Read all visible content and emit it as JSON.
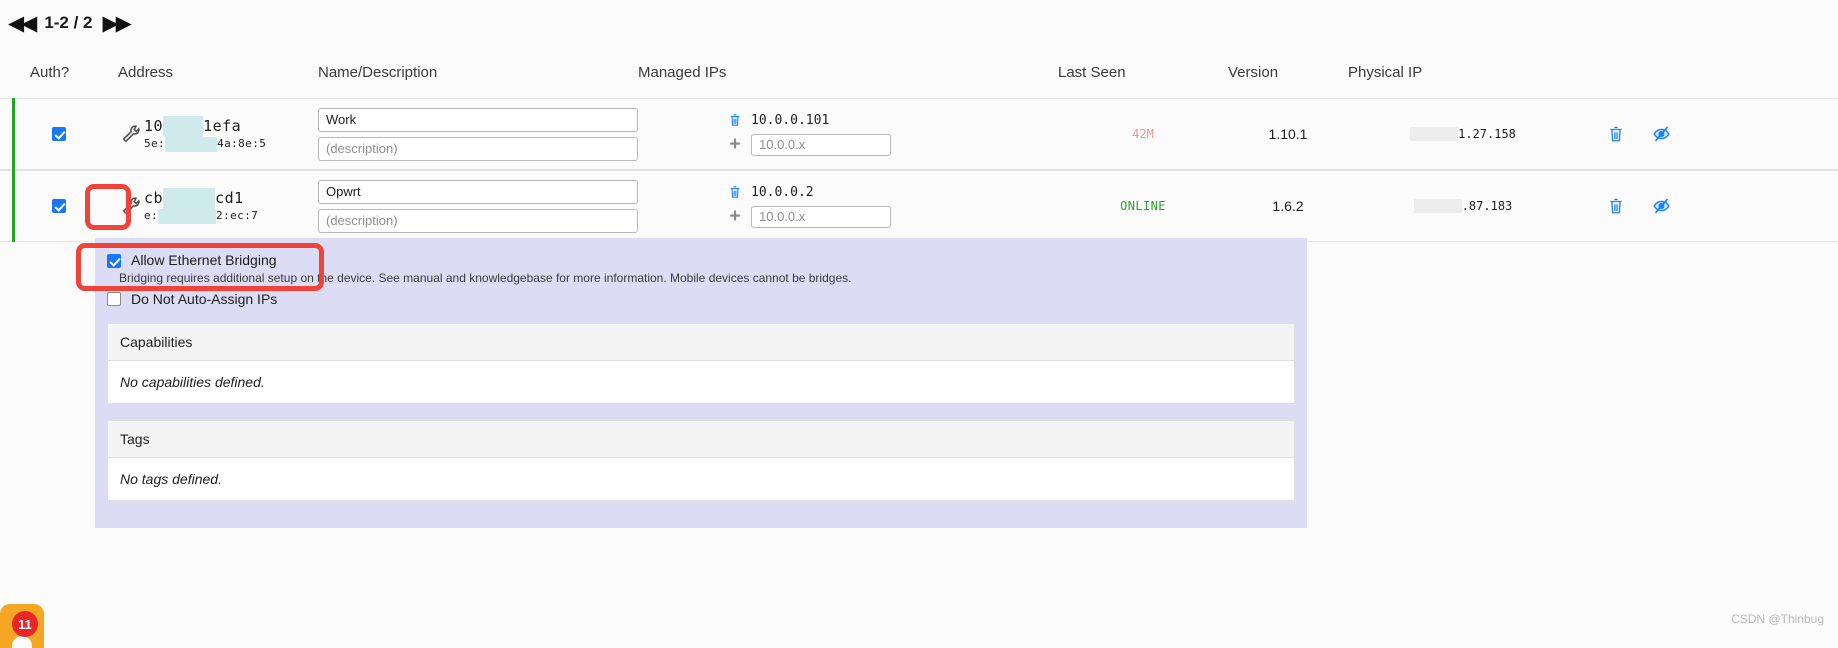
{
  "pagination": {
    "first_icon": "first-page-icon",
    "label": "1-2 / 2",
    "last_icon": "last-page-icon",
    "first_glyph": "◀◀",
    "last_glyph": "▶▶"
  },
  "table": {
    "columns": [
      "Auth?",
      "Address",
      "Name/Description",
      "Managed IPs",
      "Last Seen",
      "Version",
      "Physical IP"
    ],
    "rows": [
      {
        "auth_checked": true,
        "wrench_icon": "wrench-icon",
        "address_id": "10 7  1efa",
        "address_id_prefix": "10",
        "address_id_redacted": "███",
        "address_id_suffix": "1efa",
        "address_mac_prefix": "5e:",
        "address_mac_redacted": "████",
        "address_mac_suffix": "4a:8e:5",
        "name": "Work",
        "description": "",
        "description_placeholder": "(description)",
        "managed_ip": "10.0.0.101",
        "managed_ip_new": "",
        "managed_ip_placeholder": "10.0.0.x",
        "last_seen": "42M",
        "last_seen_state": "warn",
        "version": "1.10.1",
        "physical_ip_redacted": "███",
        "physical_ip": "1.27.158",
        "delete_icon": "trash-icon",
        "toggle_icon": "eye-slash-icon"
      },
      {
        "auth_checked": true,
        "wrench_icon": "wrench-icon",
        "address_id_prefix": "cb",
        "address_id_redacted": "███",
        "address_id_suffix": "cd1",
        "address_mac_prefix": "e:",
        "address_mac_redacted": "████",
        "address_mac_suffix": "2:ec:7",
        "name": "Opwrt",
        "description": "",
        "description_placeholder": "(description)",
        "managed_ip": "10.0.0.2",
        "managed_ip_new": "",
        "managed_ip_placeholder": "10.0.0.x",
        "last_seen": "ONLINE",
        "last_seen_state": "online",
        "version": "1.6.2",
        "physical_ip_redacted": "███",
        "physical_ip": ".87.183",
        "delete_icon": "trash-icon",
        "toggle_icon": "eye-slash-icon"
      }
    ]
  },
  "detail": {
    "allow_bridging": {
      "label": "Allow Ethernet Bridging",
      "checked": true,
      "help": "Bridging requires additional setup on the device. See manual and knowledgebase for more information. Mobile devices cannot be bridges."
    },
    "no_auto_assign": {
      "label": "Do Not Auto-Assign IPs",
      "checked": false
    },
    "capabilities": {
      "title": "Capabilities",
      "empty": "No capabilities defined."
    },
    "tags": {
      "title": "Tags",
      "empty": "No tags defined."
    }
  },
  "overlay": {
    "favicon_badge_count": "11",
    "watermark": "CSDN @Thinbug"
  },
  "colors": {
    "accent_blue": "#1877f2",
    "online_green": "#2f9e2f",
    "warn_pink": "#e8949c",
    "panel_lavender": "#dcdcf5",
    "annotation_red": "#f0443a",
    "row_marker_green": "#1ea81e",
    "address_highlight": "#d6f7f7"
  }
}
